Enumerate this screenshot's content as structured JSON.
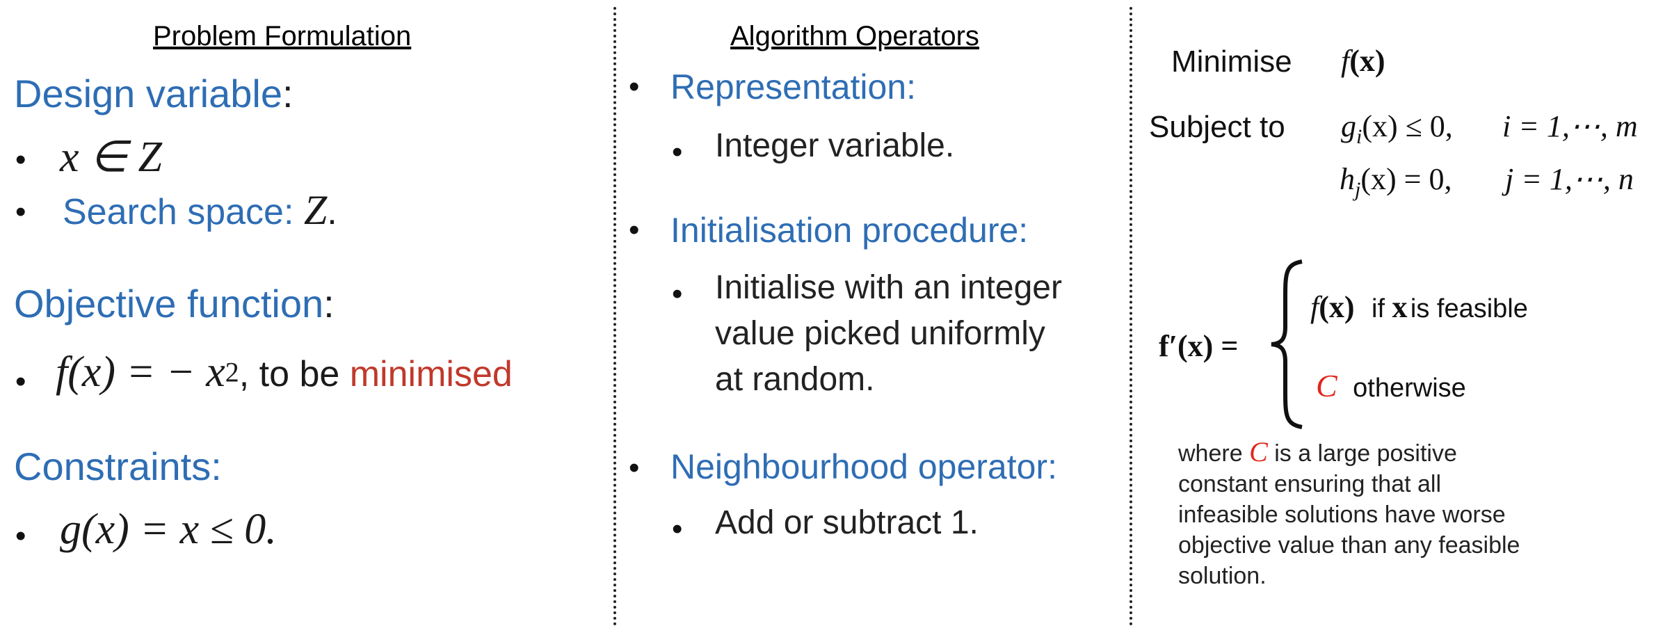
{
  "col1": {
    "heading": "Problem Formulation",
    "design_variable_label": "Design variable",
    "colon": ":",
    "x_in_Z": "x ∈ Z",
    "search_space_label": "Search space: ",
    "search_space_value": "Z",
    "period": ".",
    "objective_label": "Objective function",
    "objective_math": "f(x) = − x",
    "objective_exp": "2",
    "objective_text": ", to be ",
    "objective_minimised": "minimised",
    "constraints_label": "Constraints:",
    "constraint_math": "g(x) = x ≤ 0."
  },
  "col2": {
    "heading": "Algorithm Operators",
    "representation_label": "Representation:",
    "representation_item": "Integer variable.",
    "init_label": "Initialisation procedure:",
    "init_item_line1": "Initialise with an integer",
    "init_item_line2": "value picked uniformly",
    "init_item_line3": "at random.",
    "neighbour_label": "Neighbourhood operator:",
    "neighbour_item": "Add or subtract 1."
  },
  "col3": {
    "minimise_label": "Minimise",
    "minimise_f": "f",
    "minimise_x": "(x)",
    "subject_to_label": "Subject to",
    "g_constraint": "g",
    "g_sub": "i",
    "g_rest": "(x) ≤ 0,",
    "g_index": "i = 1,⋯, m",
    "h_constraint": "h",
    "h_sub": "j",
    "h_rest": "(x) = 0,",
    "h_index": "j = 1,⋯, n",
    "fprime": "f′(x) =",
    "case1_f": "f",
    "case1_x": "(x)",
    "case1_if": "if",
    "case1_xb": "x",
    "case1_tail": "is feasible",
    "case2_C": "C",
    "case2_tail": "otherwise",
    "note_where": "where ",
    "note_C": "C",
    "note_line1_tail": " is a large positive",
    "note_line2": "constant ensuring that all",
    "note_line3": "infeasible solutions have worse",
    "note_line4": "objective value than any feasible",
    "note_line5": "solution."
  }
}
